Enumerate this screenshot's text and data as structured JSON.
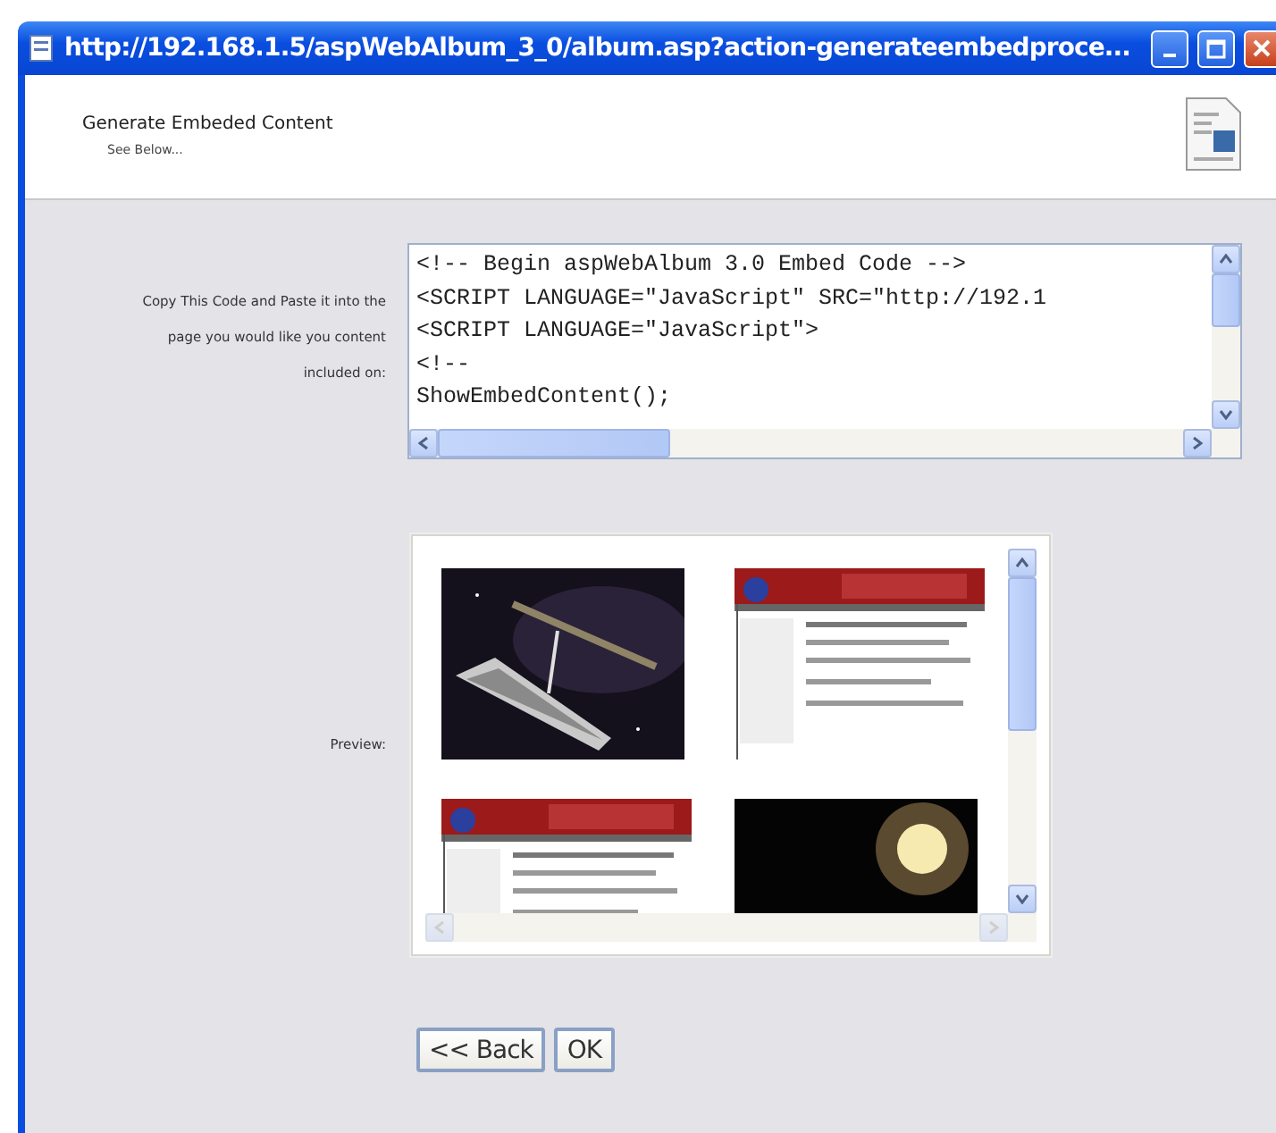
{
  "window": {
    "title": "http://192.168.1.5/aspWebAlbum_3_0/album.asp?action-generateembedproce..."
  },
  "header": {
    "title": "Generate Embeded Content",
    "subtitle": "See Below..."
  },
  "code": {
    "label_lines": [
      "Copy This Code and Paste it into the",
      "page you would like you content",
      "included on:"
    ],
    "lines": [
      "<!-- Begin aspWebAlbum 3.0 Embed Code -->",
      "<SCRIPT LANGUAGE=\"JavaScript\" SRC=\"http://192.1",
      "<SCRIPT LANGUAGE=\"JavaScript\">",
      "<!--",
      "ShowEmbedContent();"
    ]
  },
  "preview": {
    "label": "Preview:"
  },
  "buttons": [
    "<< Back",
    "OK"
  ]
}
